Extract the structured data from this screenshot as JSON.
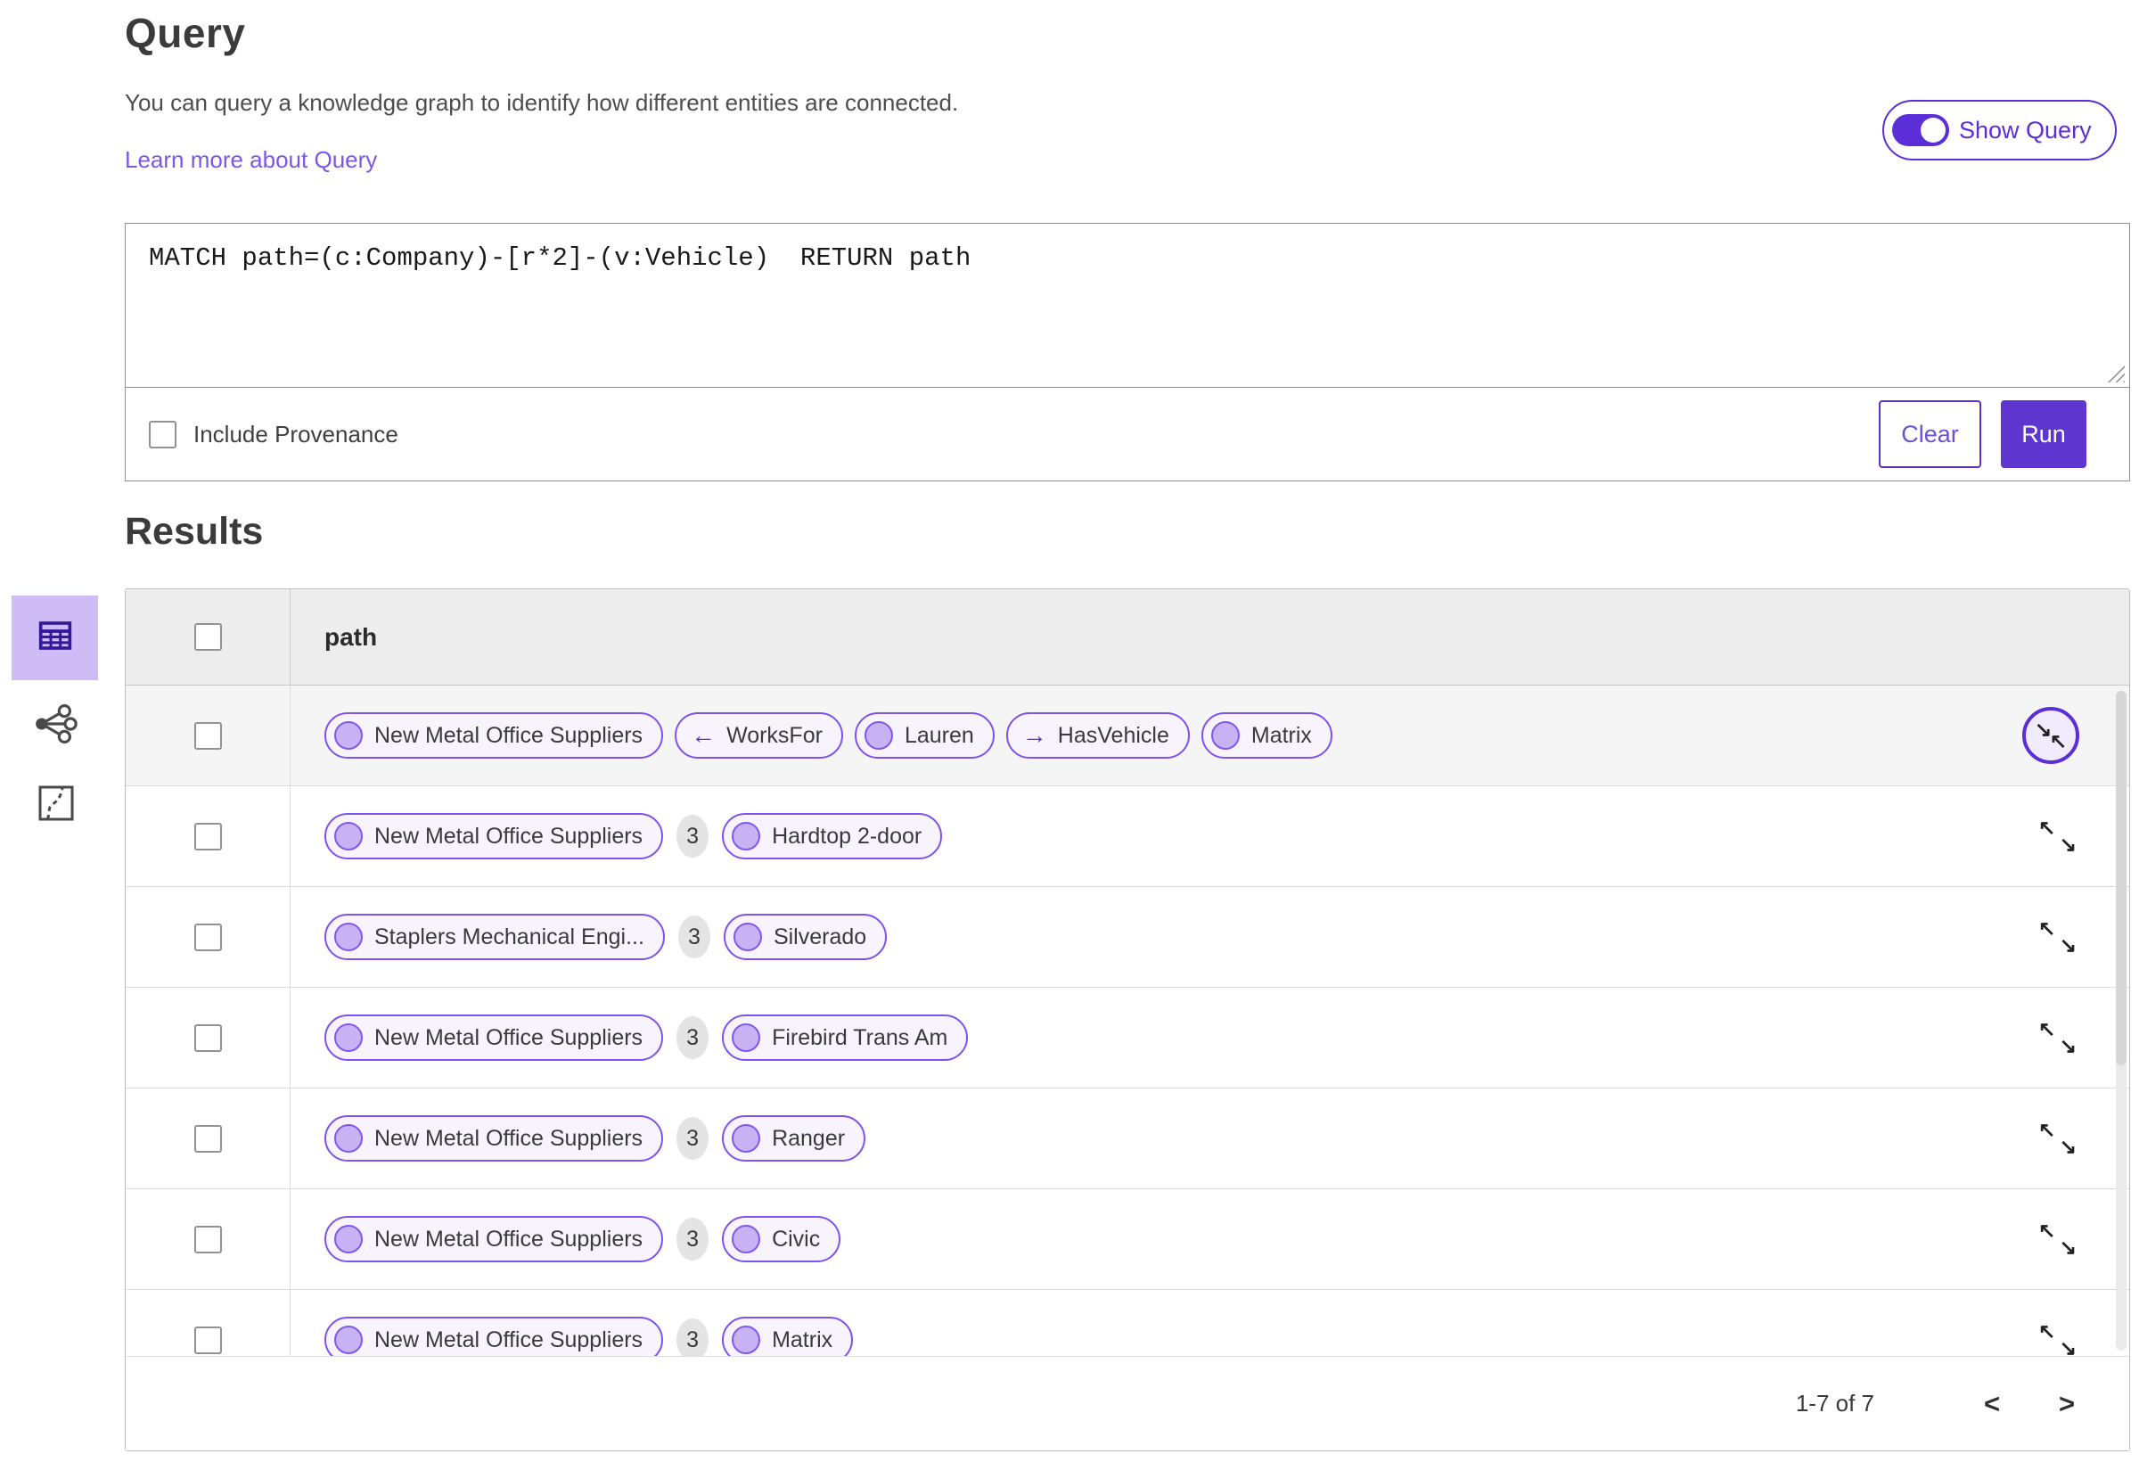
{
  "colors": {
    "accent": "#5b2ed8",
    "run_button_fill": "#5f35cf",
    "pill_border": "#7e52ee",
    "pill_bg": "#f7f4fe",
    "node_dot_fill": "#c7b2f3",
    "selected_view_bg": "#cfbcf7",
    "selected_view_icon": "#32199b",
    "link": "#7b57e8",
    "table_header_bg": "#ededed",
    "count_badge_bg": "#e4e4e4",
    "hovered_row_bg": "#f5f5f5"
  },
  "icons": {
    "arrow_left": "←",
    "arrow_right": "→",
    "arrow_nw": "↖",
    "arrow_se": "↘",
    "chevron_left": "<",
    "chevron_right": ">"
  },
  "header": {
    "title": "Query",
    "description": "You can query a knowledge graph to identify how different entities are connected.",
    "learn_more_label": "Learn more about Query",
    "show_query_label": "Show Query"
  },
  "query": {
    "text": "MATCH path=(c:Company)-[r*2]-(v:Vehicle)  RETURN path",
    "include_provenance_label": "Include Provenance",
    "clear_label": "Clear",
    "run_label": "Run"
  },
  "results": {
    "title": "Results",
    "column_header": "path",
    "view_switcher": {
      "options": [
        "table-view",
        "graph-view",
        "map-view"
      ],
      "selected": "table-view"
    },
    "rows": [
      {
        "state": "hovered",
        "items": [
          {
            "type": "node",
            "label": "New Metal Office Suppliers"
          },
          {
            "type": "edge",
            "direction": "left",
            "label": "WorksFor"
          },
          {
            "type": "node",
            "label": "Lauren"
          },
          {
            "type": "edge",
            "direction": "right",
            "label": "HasVehicle"
          },
          {
            "type": "node",
            "label": "Matrix"
          }
        ]
      },
      {
        "items": [
          {
            "type": "node",
            "label": "New Metal Office Suppliers"
          },
          {
            "type": "count",
            "label": "3"
          },
          {
            "type": "node",
            "label": "Hardtop 2-door"
          }
        ]
      },
      {
        "items": [
          {
            "type": "node",
            "label": "Staplers Mechanical Engi..."
          },
          {
            "type": "count",
            "label": "3"
          },
          {
            "type": "node",
            "label": "Silverado"
          }
        ]
      },
      {
        "items": [
          {
            "type": "node",
            "label": "New Metal Office Suppliers"
          },
          {
            "type": "count",
            "label": "3"
          },
          {
            "type": "node",
            "label": "Firebird Trans Am"
          }
        ]
      },
      {
        "items": [
          {
            "type": "node",
            "label": "New Metal Office Suppliers"
          },
          {
            "type": "count",
            "label": "3"
          },
          {
            "type": "node",
            "label": "Ranger"
          }
        ]
      },
      {
        "items": [
          {
            "type": "node",
            "label": "New Metal Office Suppliers"
          },
          {
            "type": "count",
            "label": "3"
          },
          {
            "type": "node",
            "label": "Civic"
          }
        ]
      },
      {
        "items": [
          {
            "type": "node",
            "label": "New Metal Office Suppliers"
          },
          {
            "type": "count",
            "label": "3"
          },
          {
            "type": "node",
            "label": "Matrix"
          }
        ]
      }
    ],
    "pagination": {
      "range_label": "1-7 of 7"
    }
  }
}
